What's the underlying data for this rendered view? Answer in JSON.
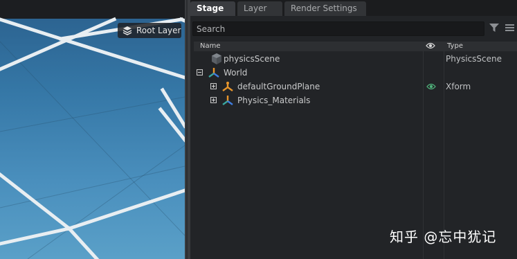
{
  "viewport": {
    "layer_badge": "Root Layer",
    "icon": "layers-icon"
  },
  "tabs": [
    {
      "label": "Stage",
      "active": true
    },
    {
      "label": "Layer",
      "active": false
    },
    {
      "label": "Render Settings",
      "active": false
    }
  ],
  "search": {
    "placeholder": "Search",
    "value": ""
  },
  "toolbar_icons": [
    "filter-icon",
    "menu-icon"
  ],
  "tree": {
    "columns": {
      "name": "Name",
      "visibility": "eye-icon",
      "type": "Type"
    },
    "rows": [
      {
        "name": "physicsScene",
        "type": "PhysicsScene",
        "icon": "cube-icon",
        "expander": "none",
        "visible_icon": false
      },
      {
        "name": "World",
        "type": "",
        "icon": "xform-icon",
        "expander": "minus",
        "visible_icon": false
      },
      {
        "name": "defaultGroundPlane",
        "type": "Xform",
        "icon": "xform-icon",
        "expander": "plus",
        "visible_icon": true
      },
      {
        "name": "Physics_Materials",
        "type": "",
        "icon": "xform-icon",
        "expander": "plus",
        "visible_icon": false
      }
    ]
  },
  "watermark": "知乎 @忘中犹记",
  "colors": {
    "panel_bg": "#222427",
    "viewport_blue": "#3a7fb0",
    "xform_orange": "#e8962c",
    "xform_teal": "#3aa6a0",
    "xform_blue": "#3f7de0"
  }
}
